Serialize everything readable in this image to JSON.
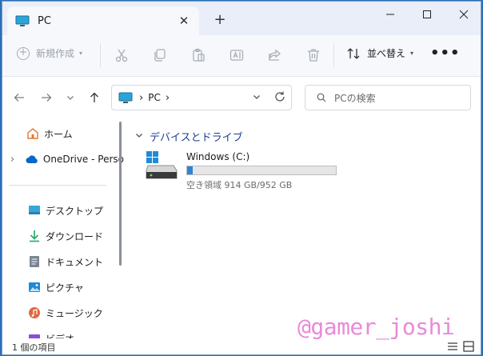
{
  "tab": {
    "title": "PC",
    "close": "✕",
    "new": "+"
  },
  "window_controls": {
    "minimize": "—",
    "maximize": "☐",
    "close": "✕"
  },
  "toolbar": {
    "new_label": "新規作成",
    "sort_label": "並べ替え",
    "more": "•••"
  },
  "address": {
    "crumb": "PC",
    "sep": "›"
  },
  "search": {
    "placeholder": "PCの検索"
  },
  "sidebar": {
    "items": [
      {
        "label": "ホーム",
        "icon": "home-icon"
      },
      {
        "label": "OneDrive - Perso",
        "icon": "cloud-icon",
        "expand": "›"
      },
      {
        "label": "デスクトップ",
        "icon": "desktop-icon"
      },
      {
        "label": "ダウンロード",
        "icon": "download-icon"
      },
      {
        "label": "ドキュメント",
        "icon": "document-icon"
      },
      {
        "label": "ピクチャ",
        "icon": "picture-icon"
      },
      {
        "label": "ミュージック",
        "icon": "music-icon"
      },
      {
        "label": "ビデオ",
        "icon": "video-icon"
      }
    ]
  },
  "main": {
    "group_title": "デバイスとドライブ",
    "drive": {
      "name": "Windows (C:)",
      "free_text": "空き領域 914 GB/952 GB",
      "used_fraction": 0.04
    }
  },
  "status": {
    "count": "1 個の項目"
  },
  "watermark": "@gamer_joshi",
  "colors": {
    "accent": "#2d84d6",
    "group_title": "#1a3f8f",
    "watermark": "#e88ad8"
  }
}
